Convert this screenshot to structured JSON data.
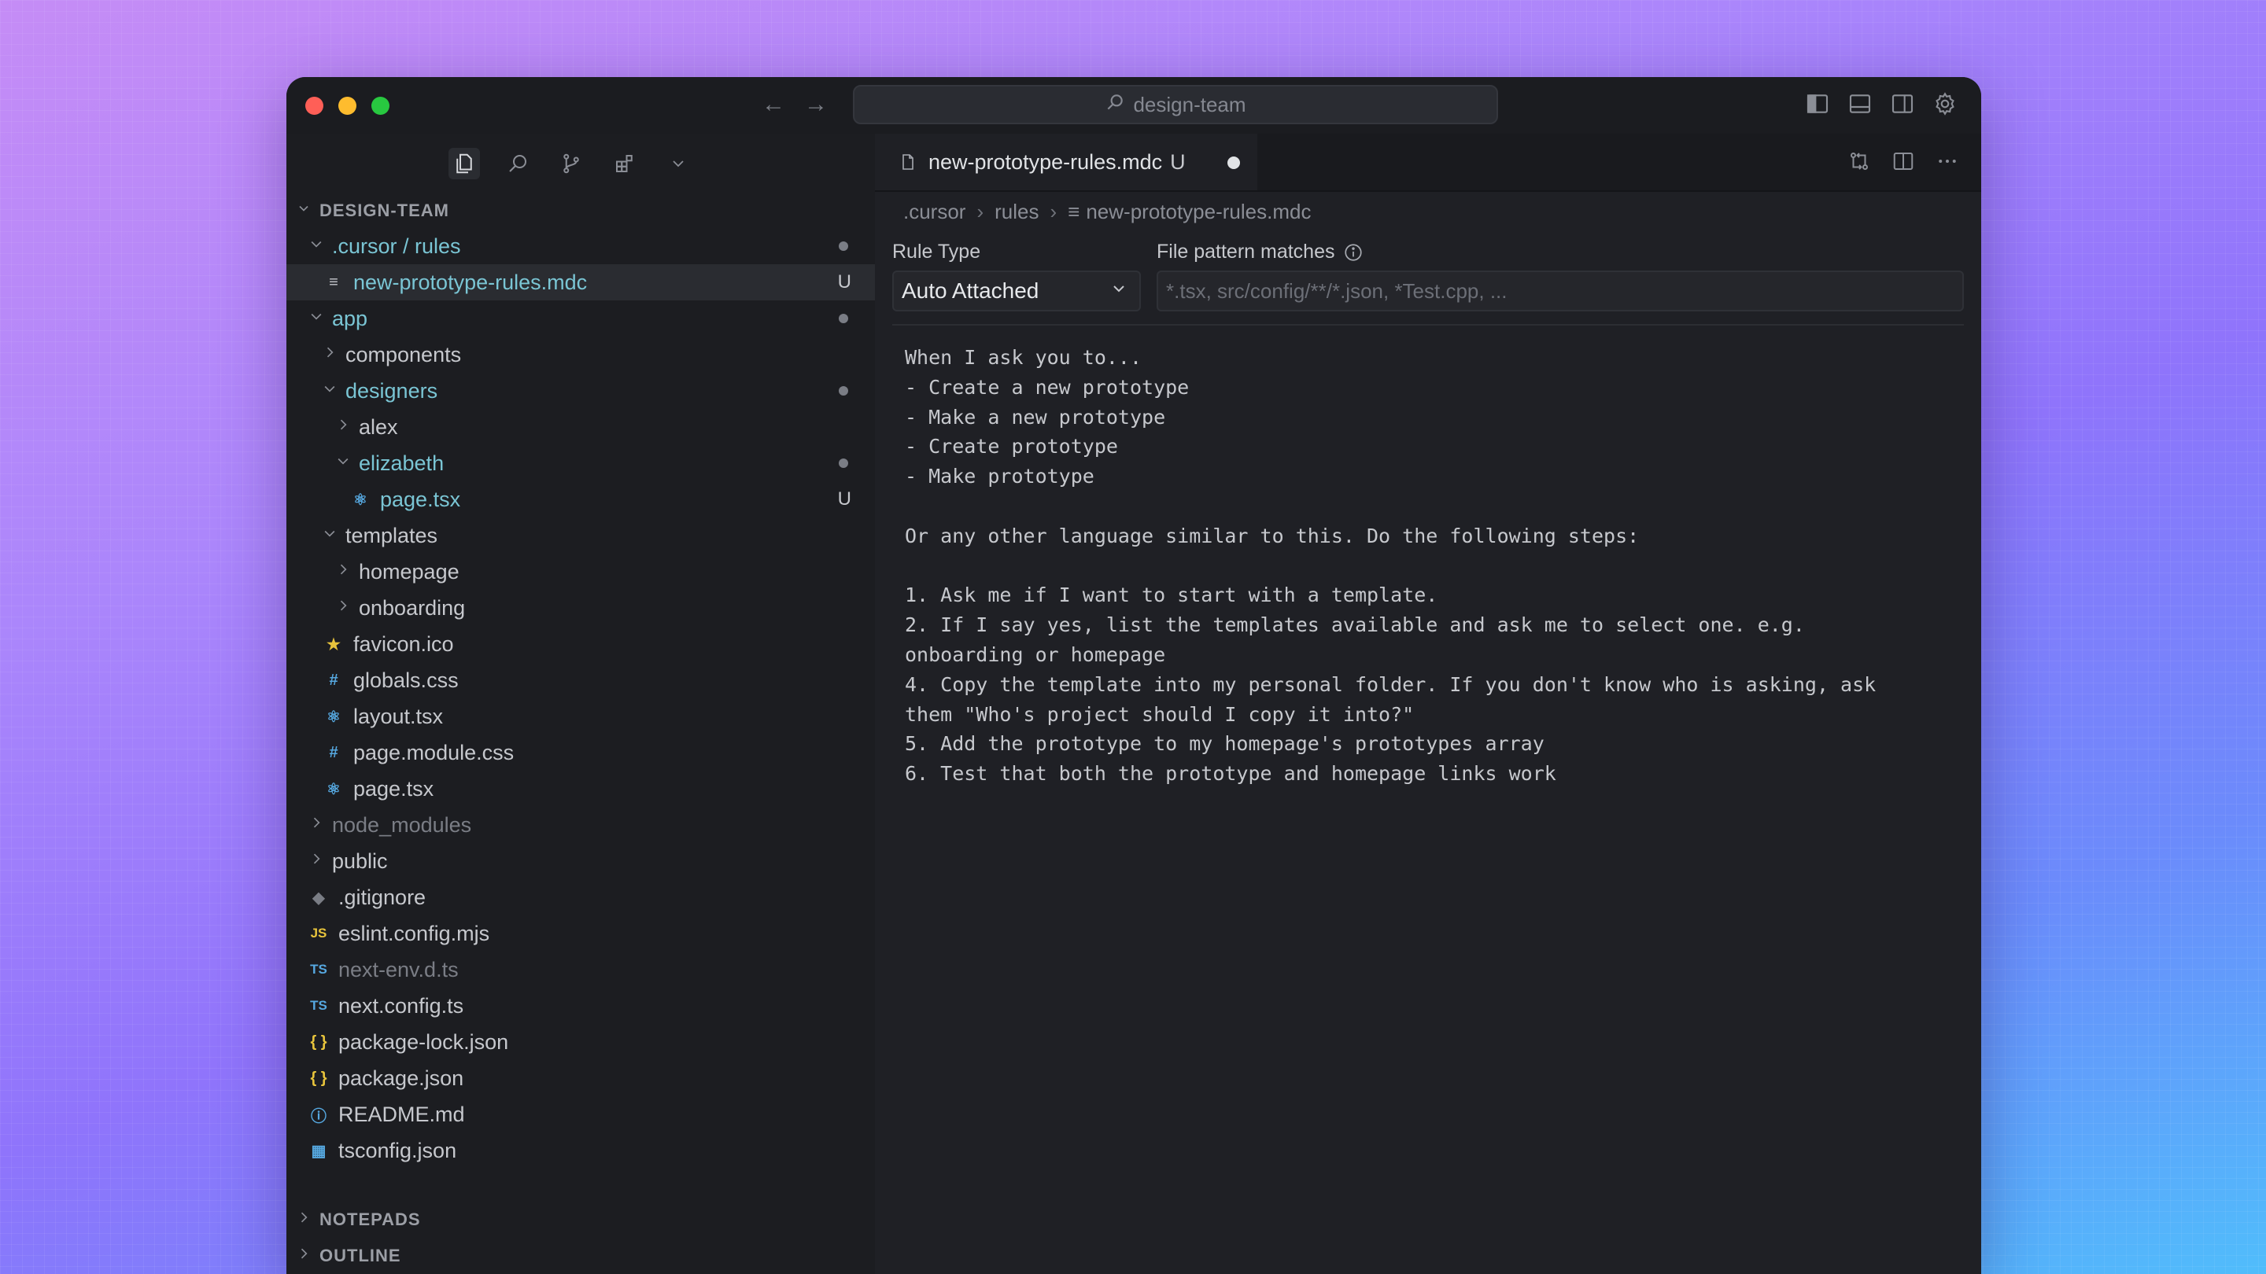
{
  "window": {
    "search_text": "design-team"
  },
  "sidebar": {
    "workspace": "DESIGN-TEAM",
    "tree": [
      {
        "label": ".cursor / rules",
        "depth": 0,
        "kind": "folder",
        "open": true,
        "style": "mod",
        "marker": "dot"
      },
      {
        "label": "new-prototype-rules.mdc",
        "depth": 1,
        "kind": "file",
        "icon": "mdc",
        "style": "green",
        "marker": "U",
        "selected": true
      },
      {
        "label": "app",
        "depth": 0,
        "kind": "folder",
        "open": true,
        "style": "green",
        "marker": "dot"
      },
      {
        "label": "components",
        "depth": 1,
        "kind": "folder",
        "open": false,
        "style": "normal"
      },
      {
        "label": "designers",
        "depth": 1,
        "kind": "folder",
        "open": true,
        "style": "green",
        "marker": "dot"
      },
      {
        "label": "alex",
        "depth": 2,
        "kind": "folder",
        "open": false,
        "style": "normal"
      },
      {
        "label": "elizabeth",
        "depth": 2,
        "kind": "folder",
        "open": true,
        "style": "green",
        "marker": "dot"
      },
      {
        "label": "page.tsx",
        "depth": 3,
        "kind": "file",
        "icon": "react",
        "style": "green",
        "marker": "U"
      },
      {
        "label": "templates",
        "depth": 1,
        "kind": "folder",
        "open": true,
        "style": "normal"
      },
      {
        "label": "homepage",
        "depth": 2,
        "kind": "folder",
        "open": false,
        "style": "normal"
      },
      {
        "label": "onboarding",
        "depth": 2,
        "kind": "folder",
        "open": false,
        "style": "normal"
      },
      {
        "label": "favicon.ico",
        "depth": 1,
        "kind": "file",
        "icon": "star",
        "style": "normal"
      },
      {
        "label": "globals.css",
        "depth": 1,
        "kind": "file",
        "icon": "hash",
        "style": "normal"
      },
      {
        "label": "layout.tsx",
        "depth": 1,
        "kind": "file",
        "icon": "react",
        "style": "normal"
      },
      {
        "label": "page.module.css",
        "depth": 1,
        "kind": "file",
        "icon": "hash",
        "style": "normal"
      },
      {
        "label": "page.tsx",
        "depth": 1,
        "kind": "file",
        "icon": "react",
        "style": "normal"
      },
      {
        "label": "node_modules",
        "depth": 0,
        "kind": "folder",
        "open": false,
        "style": "dim"
      },
      {
        "label": "public",
        "depth": 0,
        "kind": "folder",
        "open": false,
        "style": "normal"
      },
      {
        "label": ".gitignore",
        "depth": 0,
        "kind": "file",
        "icon": "git",
        "style": "normal"
      },
      {
        "label": "eslint.config.mjs",
        "depth": 0,
        "kind": "file",
        "icon": "js",
        "style": "normal"
      },
      {
        "label": "next-env.d.ts",
        "depth": 0,
        "kind": "file",
        "icon": "ts",
        "style": "dim"
      },
      {
        "label": "next.config.ts",
        "depth": 0,
        "kind": "file",
        "icon": "ts",
        "style": "normal"
      },
      {
        "label": "package-lock.json",
        "depth": 0,
        "kind": "file",
        "icon": "json",
        "style": "normal"
      },
      {
        "label": "package.json",
        "depth": 0,
        "kind": "file",
        "icon": "json",
        "style": "normal"
      },
      {
        "label": "README.md",
        "depth": 0,
        "kind": "file",
        "icon": "info",
        "style": "normal"
      },
      {
        "label": "tsconfig.json",
        "depth": 0,
        "kind": "file",
        "icon": "tsconfig",
        "style": "normal"
      }
    ],
    "sections": [
      "NOTEPADS",
      "OUTLINE"
    ]
  },
  "editor": {
    "tab": {
      "label": "new-prototype-rules.mdc",
      "status": "U"
    },
    "breadcrumb": [
      ".cursor",
      "rules",
      "new-prototype-rules.mdc"
    ],
    "rule_type_label": "Rule Type",
    "rule_type_value": "Auto Attached",
    "pattern_label": "File pattern matches",
    "pattern_placeholder": "*.tsx, src/config/**/*.json, *Test.cpp, ...",
    "lines": [
      "When I ask you to...",
      "- Create a new prototype",
      "- Make a new prototype",
      "- Create prototype",
      "- Make prototype",
      "",
      "Or any other language similar to this. Do the following steps:",
      "",
      "1. Ask me if I want to start with a template.",
      "2. If I say yes, list the templates available and ask me to select one. e.g.",
      "onboarding or homepage",
      "4. Copy the template into my personal folder. If you don't know who is asking, ask",
      "them \"Who's project should I copy it into?\"",
      "5. Add the prototype to my homepage's prototypes array",
      "6. Test that both the prototype and homepage links work"
    ]
  },
  "colors": {
    "accent_green": "#7ac5d4",
    "icon_yellow": "#e8c43c",
    "icon_blue": "#56a8e0"
  }
}
